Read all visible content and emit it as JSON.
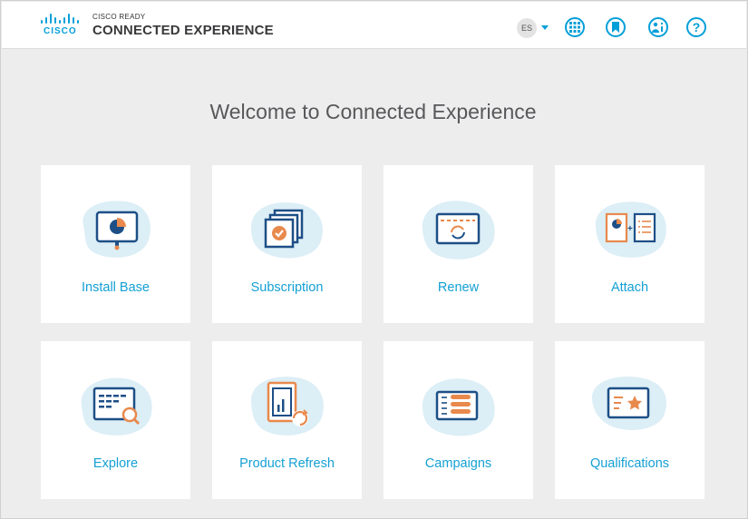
{
  "header": {
    "logo_text": "CISCO",
    "brand_small": "CISCO READY",
    "brand_title": "CONNECTED EXPERIENCE",
    "language": "ES",
    "icons": [
      "grid-icon",
      "bookmark-icon",
      "user-info-icon",
      "help-icon"
    ],
    "help_glyph": "?"
  },
  "main": {
    "welcome": "Welcome to Connected Experience"
  },
  "cards": [
    {
      "label": "Install Base",
      "icon": "monitor-pie-chart-icon"
    },
    {
      "label": "Subscription",
      "icon": "subscription-check-icon"
    },
    {
      "label": "Renew",
      "icon": "renew-window-icon"
    },
    {
      "label": "Attach",
      "icon": "attach-documents-icon"
    },
    {
      "label": "Explore",
      "icon": "explore-search-icon"
    },
    {
      "label": "Product Refresh",
      "icon": "product-refresh-icon"
    },
    {
      "label": "Campaigns",
      "icon": "campaigns-list-icon"
    },
    {
      "label": "Qualifications",
      "icon": "qualifications-star-icon"
    }
  ],
  "colors": {
    "accent": "#049fd9",
    "link": "#14a0d4",
    "orange": "#e8894d",
    "blob": "#dceef6",
    "navy": "#1d4f86"
  }
}
